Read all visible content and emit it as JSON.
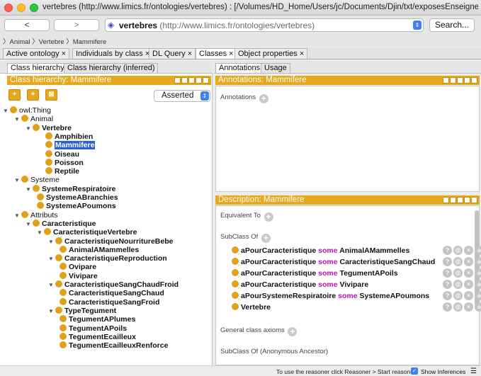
{
  "window": {
    "title": "vertebres (http://www.limics.fr/ontologies/vertebres)  : [/Volumes/HD_Home/Users/jc/Documents/Djin/txt/exposesEnseignement/mate..."
  },
  "toolbar": {
    "back_label": "<",
    "forward_label": ">",
    "ontology_name": "vertebres",
    "ontology_iri": "(http://www.limics.fr/ontologies/vertebres)",
    "search_label": "Search..."
  },
  "breadcrumb": "〉Animal 〉Vertebre 〉Mammifere",
  "main_tabs": [
    {
      "label": "Active ontology ×"
    },
    {
      "label": "Individuals by class ×"
    },
    {
      "label": "DL Query ×"
    },
    {
      "label": "Classes ×"
    },
    {
      "label": "Object properties ×"
    }
  ],
  "left": {
    "tabs": [
      {
        "label": "Class hierarchy"
      },
      {
        "label": "Class hierarchy (inferred)"
      }
    ],
    "header": "Class hierarchy: Mammifere",
    "mode": "Asserted",
    "tree": [
      {
        "label": "owl:Thing",
        "plain": true,
        "tw": "▼"
      },
      {
        "label": "Animal",
        "plain": true,
        "tw": "▼"
      },
      {
        "label": "Vertebre",
        "plain": false,
        "tw": "▼"
      },
      {
        "label": "Amphibien",
        "plain": false,
        "tw": ""
      },
      {
        "label": "Mammifere",
        "plain": false,
        "tw": "",
        "selected": true
      },
      {
        "label": "Oiseau",
        "plain": false,
        "tw": ""
      },
      {
        "label": "Poisson",
        "plain": false,
        "tw": ""
      },
      {
        "label": "Reptile",
        "plain": false,
        "tw": ""
      },
      {
        "label": "Systeme",
        "plain": true,
        "tw": "▼"
      },
      {
        "label": "SystemeRespiratoire",
        "plain": false,
        "tw": "▼"
      },
      {
        "label": "SystemeABranchies",
        "plain": false,
        "tw": ""
      },
      {
        "label": "SystemeAPoumons",
        "plain": false,
        "tw": ""
      },
      {
        "label": "Attributs",
        "plain": true,
        "tw": "▼"
      },
      {
        "label": "Caracteristique",
        "plain": false,
        "tw": "▼"
      },
      {
        "label": "CaracteristiqueVertebre",
        "plain": false,
        "tw": "▼"
      },
      {
        "label": "CaracteristiqueNourritureBebe",
        "plain": false,
        "tw": "▼"
      },
      {
        "label": "AnimalAMammelles",
        "plain": false,
        "tw": ""
      },
      {
        "label": "CaracteristiqueReproduction",
        "plain": false,
        "tw": "▼"
      },
      {
        "label": "Ovipare",
        "plain": false,
        "tw": ""
      },
      {
        "label": "Vivipare",
        "plain": false,
        "tw": ""
      },
      {
        "label": "CaracteristiqueSangChaudFroid",
        "plain": false,
        "tw": "▼"
      },
      {
        "label": "CaracteristiqueSangChaud",
        "plain": false,
        "tw": ""
      },
      {
        "label": "CaracteristiqueSangFroid",
        "plain": false,
        "tw": ""
      },
      {
        "label": "TypeTegument",
        "plain": false,
        "tw": "▼"
      },
      {
        "label": "TegumentAPlumes",
        "plain": false,
        "tw": ""
      },
      {
        "label": "TegumentAPoils",
        "plain": false,
        "tw": ""
      },
      {
        "label": "TegumentEcailleux",
        "plain": false,
        "tw": ""
      },
      {
        "label": "TegumentEcailleuxRenforce",
        "plain": false,
        "tw": ""
      }
    ]
  },
  "right": {
    "tabs": [
      {
        "label": "Annotations"
      },
      {
        "label": "Usage"
      }
    ],
    "annotations_header": "Annotations: Mammifere",
    "annotations_label": "Annotations",
    "description_header": "Description: Mammifere",
    "equivalent_label": "Equivalent To",
    "subclass_label": "SubClass Of",
    "subclass_rows": [
      {
        "prop": "aPourCaracteristique",
        "kw": "some",
        "filler": "AnimalAMammelles"
      },
      {
        "prop": "aPourCaracteristique",
        "kw": "some",
        "filler": "CaracteristiqueSangChaud"
      },
      {
        "prop": "aPourCaracteristique",
        "kw": "some",
        "filler": "TegumentAPoils"
      },
      {
        "prop": "aPourCaracteristique",
        "kw": "some",
        "filler": "Vivipare"
      },
      {
        "prop": "aPourSystemeRespiratoire",
        "kw": "some",
        "filler": "SystemeAPoumons"
      },
      {
        "prop": "Vertebre",
        "kw": "",
        "filler": ""
      }
    ],
    "general_axioms_label": "General class axioms",
    "anon_ancestor_label": "SubClass Of (Anonymous Ancestor)"
  },
  "status": {
    "message": "To use the reasoner click Reasoner > Start reasoner",
    "show_inferences_label": "Show Inferences"
  }
}
